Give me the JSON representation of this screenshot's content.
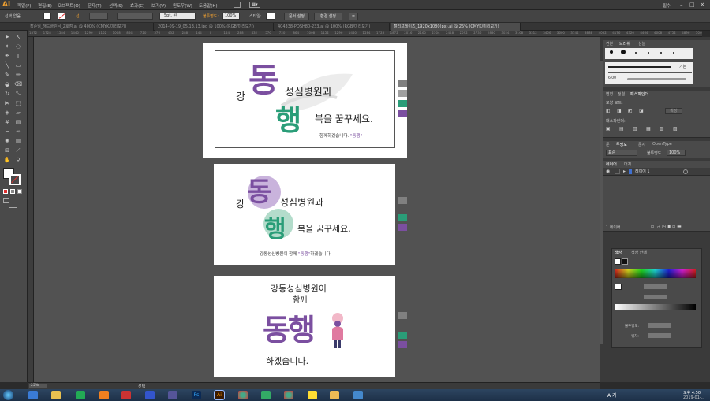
{
  "app": {
    "logo": "Ai"
  },
  "menu": {
    "items": [
      "파일(F)",
      "편집(E)",
      "오브젝트(O)",
      "문자(T)",
      "선택(S)",
      "효과(C)",
      "보기(V)",
      "윈도우(W)",
      "도움말(H)"
    ],
    "right_label": "필수"
  },
  "control_bar": {
    "selection_label": "선택 없음",
    "stroke_label": "선:",
    "brush_size": "5pt. 원",
    "opacity_label": "불투명도:",
    "opacity_value": "100%",
    "style_label": "스타일:",
    "doc_setup": "문서 설정",
    "preferences": "환경 설정"
  },
  "doc_tabs": [
    "장준님_해드클린닉_2호점.ai @ 400% (CMYK/미리보기)",
    "2014-09-19_05.13.13.jpg @ 100% (RGB/미리보기)",
    "404338-POSH80-233.ai @ 100% (RGB/미리보기)",
    "캘리프레이즈_1920x1080(px).ai @ 25% (CMYK/미리보기)"
  ],
  "active_tab_index": 3,
  "ruler_numbers": [
    "1872",
    "1728",
    "1584",
    "1440",
    "1296",
    "1152",
    "1008",
    "864",
    "720",
    "576",
    "432",
    "288",
    "144",
    "0",
    "144",
    "288",
    "432",
    "576",
    "720",
    "864",
    "1008",
    "1152",
    "1296",
    "1440",
    "1584",
    "1728",
    "1872",
    "2016",
    "2160",
    "2304",
    "2448",
    "2592",
    "2736",
    "2880",
    "3024",
    "3168",
    "3312",
    "3456",
    "3600",
    "3744",
    "3888",
    "4032",
    "4176",
    "4320",
    "4464",
    "4608",
    "4752",
    "4896",
    "5040"
  ],
  "artboards": [
    {
      "line1": "강",
      "big1": "동",
      "line1_rest": "성심병원과",
      "big2": "행",
      "line2_rest": "복을 꿈꾸세요.",
      "footer": "함께하겠습니다.",
      "footer_quote": "\"동행\""
    },
    {
      "line1": "강",
      "big1": "동",
      "line1_rest": "성심병원과",
      "big2": "행",
      "line2_rest": "복을 꿈꾸세요.",
      "footer": "강동성심병원이 함께",
      "footer_quote": "\"동행\"",
      "footer_end": "하겠습니다."
    },
    {
      "line1": "강동성심병원이",
      "line2": "함께",
      "big": "동행",
      "line3": "하겠습니다."
    }
  ],
  "swatch_colors": [
    "#808080",
    "#a0a0a0",
    "#2a9d78",
    "#7b4fa0"
  ],
  "colors": {
    "purple": "#7b4fa0",
    "green": "#2a9d78",
    "pink": "#e6a0c0"
  },
  "panels": {
    "brush_tabs": [
      "견본",
      "브러쉬",
      "심볼"
    ],
    "brush_basic": "기본",
    "brush_size": "6.00",
    "transform_tabs": [
      "변형",
      "정렬",
      "패스파인더"
    ],
    "shape_mode": "모양 모드:",
    "expand": "확장",
    "pathfinder": "패스파인더:",
    "char_tabs": [
      "문",
      "투명도",
      "문자",
      "OpenType"
    ],
    "blend_mode": "표준",
    "opacity_label": "불투명도",
    "opacity": "100%",
    "layer_tabs": [
      "레이어",
      "대지"
    ],
    "layer_name": "레이어 1",
    "layer_count": "1 레이어",
    "color_tabs": [
      "색상",
      "색상 안내"
    ],
    "gradient_label": "불투명도:",
    "location_label": "위치:"
  },
  "status": {
    "zoom": "25%",
    "mode": "선택"
  },
  "taskbar": {
    "time": "오후 4:50",
    "date": "2019-01-..",
    "lang": "A 가"
  }
}
